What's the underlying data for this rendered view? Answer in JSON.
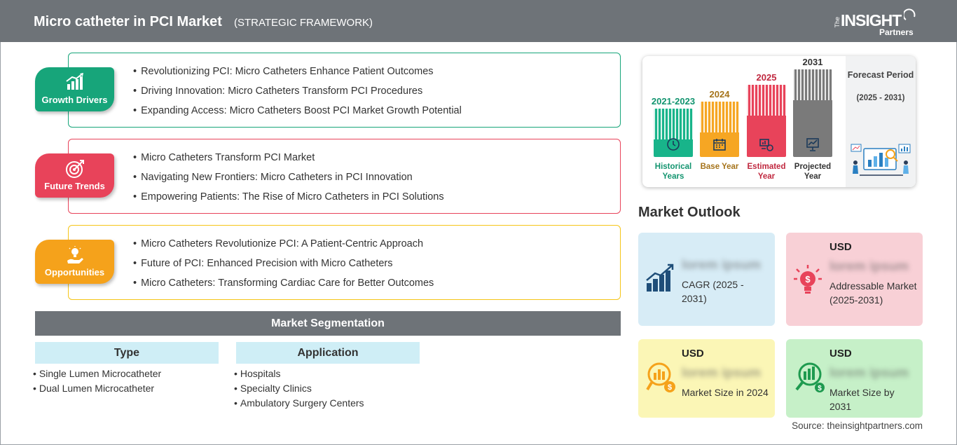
{
  "header": {
    "title": "Micro catheter in PCI Market",
    "subtitle": "(STRATEGIC FRAMEWORK)",
    "logo": {
      "the": "The",
      "insight": "INSIGHT",
      "partners": "Partners"
    }
  },
  "framework": [
    {
      "label": "Growth Drivers",
      "color": "#17a57a",
      "icon": "growth-chart-icon",
      "items": [
        "Revolutionizing PCI: Micro Catheters Enhance Patient Outcomes",
        "Driving Innovation: Micro Catheters Transform PCI Procedures",
        "Expanding Access: Micro Catheters Boost PCI Market Growth Potential"
      ]
    },
    {
      "label": "Future Trends",
      "color": "#e8435a",
      "icon": "target-icon",
      "items": [
        "Micro Catheters Transform PCI Market",
        "Navigating New Frontiers: Micro Catheters in PCI Innovation",
        "Empowering Patients: The Rise of Micro Catheters in PCI Solutions"
      ]
    },
    {
      "label": "Opportunities",
      "color": "#f5a21b",
      "icon": "lightbulb-hand-icon",
      "items": [
        "Micro Catheters Revolutionize PCI: A Patient-Centric Approach",
        "Future of PCI: Enhanced Precision with Micro Catheters",
        "Micro Catheters: Transforming Cardiac Care for Better Outcomes"
      ]
    }
  ],
  "segmentation": {
    "title": "Market Segmentation",
    "groups": [
      {
        "title": "Type",
        "items": [
          "Single Lumen Microcatheter",
          "Dual Lumen Microcatheter"
        ]
      },
      {
        "title": "Application",
        "items": [
          "Hospitals",
          "Specialty Clinics",
          "Ambulatory Surgery Centers"
        ]
      }
    ]
  },
  "timeline": {
    "bars": [
      {
        "year": "2021-2023",
        "caption": "Historical Years",
        "color": "#18b48a",
        "year_color": "#12946f",
        "icon": "history-icon",
        "level": 0.53
      },
      {
        "year": "2024",
        "caption": "Base Year",
        "color": "#f6a623",
        "year_color": "#a5731a",
        "icon": "calendar-icon",
        "level": 0.61
      },
      {
        "year": "2025",
        "caption": "Estimated Year",
        "color": "#e8435a",
        "year_color": "#c0283f",
        "icon": "estimate-icon",
        "level": 0.79
      },
      {
        "year": "2031",
        "caption": "Projected Year",
        "color": "#7a7a7a",
        "year_color": "#333333",
        "icon": "projection-icon",
        "level": 0.96
      }
    ],
    "forecast_title": "Forecast Period",
    "forecast_range": "(2025 - 2031)"
  },
  "outlook": {
    "title": "Market Outlook",
    "cards": [
      {
        "usd": "",
        "value": "lorem ipsum",
        "desc": "CAGR (2025 - 2031)",
        "color": "#d7ecf6",
        "icon": "growth-bars-icon"
      },
      {
        "usd": "USD",
        "value": "lorem ipsum",
        "desc": "Addressable Market (2025-2031)",
        "color": "#f8d0d6",
        "icon": "dollar-bulb-icon"
      },
      {
        "usd": "USD",
        "value": "lorem ipsum",
        "desc": "Market Size in 2024",
        "color": "#fbf6b6",
        "icon": "coin-chart-icon"
      },
      {
        "usd": "USD",
        "value": "lorem ipsum",
        "desc": "Market Size by 2031",
        "color": "#c6f0c8",
        "icon": "money-growth-icon"
      }
    ]
  },
  "source": "Source: theinsightpartners.com"
}
